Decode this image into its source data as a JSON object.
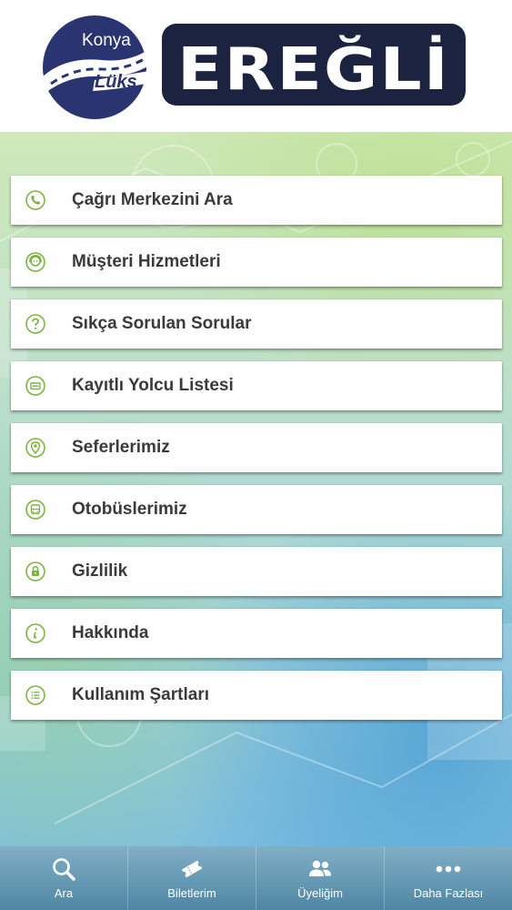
{
  "header": {
    "logo_left_line1": "Konya",
    "logo_left_line2": "Lüks",
    "logo_right": "EREĞLİ"
  },
  "menu": {
    "items": [
      {
        "label": "Çağrı Merkezini Ara",
        "icon": "phone-icon"
      },
      {
        "label": "Müşteri Hizmetleri",
        "icon": "support-agent-icon"
      },
      {
        "label": "Sıkça Sorulan Sorular",
        "icon": "question-icon"
      },
      {
        "label": "Kayıtlı Yolcu Listesi",
        "icon": "id-card-icon"
      },
      {
        "label": "Seferlerimiz",
        "icon": "location-pin-icon"
      },
      {
        "label": "Otobüslerimiz",
        "icon": "bus-icon"
      },
      {
        "label": "Gizlilik",
        "icon": "lock-icon"
      },
      {
        "label": "Hakkında",
        "icon": "info-icon"
      },
      {
        "label": "Kullanım Şartları",
        "icon": "list-icon"
      }
    ]
  },
  "tabbar": {
    "tabs": [
      {
        "label": "Ara",
        "icon": "search-icon"
      },
      {
        "label": "Biletlerim",
        "icon": "ticket-icon"
      },
      {
        "label": "Üyeliğim",
        "icon": "users-icon"
      },
      {
        "label": "Daha Fazlası",
        "icon": "more-dots-icon"
      }
    ]
  },
  "colors": {
    "accent_green": "#7cb342",
    "logo_navy": "#1f2a5c",
    "text_dark": "#3a3a3a",
    "tabbar_blue": "#5a90ad"
  }
}
